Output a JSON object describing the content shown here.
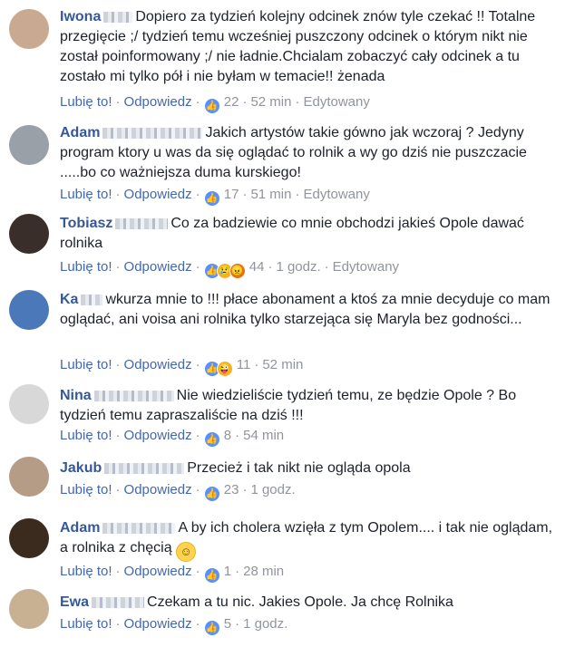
{
  "comments": [
    {
      "name": "Iwona",
      "text": "Dopiero za tydzień kolejny odcinek znów tyle czekać !! Totalne przegięcie ;/ tydzień temu wcześniej puszczony odcinek o którym nikt nie został poinformowany ;/ nie ładnie.Chcialam zobaczyć cały odcinek a tu zostało mi tylko pół i nie byłam w temacie!! żenada",
      "like_label": "Lubię to!",
      "reply_label": "Odpowiedz",
      "reaction_icons": [
        "like-icon"
      ],
      "reaction_count": "22",
      "time": "52 min",
      "edited": "Edytowany",
      "avatar_color": "#c9a98f"
    },
    {
      "name": "Adam",
      "text": "Jakich artystów takie gówno jak wczoraj ? Jedyny program ktory u was da się oglądać to rolnik a wy go dziś nie puszczacie .....bo co ważniejsza duma kurskiego!",
      "like_label": "Lubię to!",
      "reply_label": "Odpowiedz",
      "reaction_icons": [
        "like-icon"
      ],
      "reaction_count": "17",
      "time": "51 min",
      "edited": "Edytowany",
      "avatar_color": "#9aa0a8"
    },
    {
      "name": "Tobiasz",
      "text": "Co za badziewie co mnie obchodzi jakieś Opole dawać rolnika",
      "like_label": "Lubię to!",
      "reply_label": "Odpowiedz",
      "reaction_icons": [
        "like-icon",
        "sad-icon",
        "angry-icon"
      ],
      "reaction_count": "44",
      "time": "1 godz.",
      "edited": "Edytowany",
      "avatar_color": "#3a2e2a"
    },
    {
      "name": "Ka",
      "text": "wkurza mnie to !!! płace abonament a ktoś za mnie decyduje co mam oglądać, ani voisa ani rolnika tylko starzejąca się Maryla bez godności...",
      "like_label": "Lubię to!",
      "reply_label": "Odpowiedz",
      "reaction_icons": [
        "like-icon",
        "haha-icon"
      ],
      "reaction_count": "11",
      "time": "52 min",
      "edited": "",
      "avatar_color": "#4a78b8"
    },
    {
      "name": "Nina",
      "text": "Nie wiedzieliście tydzień temu, ze będzie Opole ? Bo tydzień temu zapraszaliście na dziś !!!",
      "like_label": "Lubię to!",
      "reply_label": "Odpowiedz",
      "reaction_icons": [
        "like-icon"
      ],
      "reaction_count": "8",
      "time": "54 min",
      "edited": "",
      "avatar_color": "#d8d8d8"
    },
    {
      "name": "Jakub",
      "text": "Przecież i tak nikt nie ogląda opola",
      "like_label": "Lubię to!",
      "reply_label": "Odpowiedz",
      "reaction_icons": [
        "like-icon"
      ],
      "reaction_count": "23",
      "time": "1 godz.",
      "edited": "",
      "avatar_color": "#b59c86"
    },
    {
      "name": "Adam",
      "text": "A by ich cholera wzięła z tym Opolem.... i tak nie oglądam, a rolnika z chęcią",
      "like_label": "Lubię to!",
      "reply_label": "Odpowiedz",
      "reaction_icons": [
        "like-icon"
      ],
      "reaction_count": "1",
      "time": "28 min",
      "edited": "",
      "avatar_color": "#3b2a1e"
    },
    {
      "name": "Ewa",
      "text": "Czekam a tu nic. Jakies Opole. Ja chcę Rolnika",
      "like_label": "Lubię to!",
      "reply_label": "Odpowiedz",
      "reaction_icons": [
        "like-icon"
      ],
      "reaction_count": "5",
      "time": "1 godz.",
      "edited": "",
      "avatar_color": "#c8b092"
    }
  ],
  "colors": {
    "name": "#365899",
    "link": "#4267b2",
    "meta": "#90949c",
    "text": "#1d2129"
  }
}
